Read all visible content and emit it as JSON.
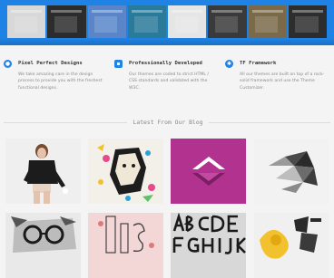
{
  "hero": {
    "thumbnail_colors": [
      "#d8d8d8",
      "#2c2c2c",
      "#5a86c9",
      "#2a7a9a",
      "#e5e5e5",
      "#3a3a3a",
      "#7a6a4a",
      "#2d2d2d"
    ]
  },
  "features": [
    {
      "title": "Pixel Perfect Designs",
      "icon": "camera-icon",
      "text": "We take amazing care in the design process to provide you with the freshest functional designs."
    },
    {
      "title": "Professionally Developed",
      "icon": "code-icon",
      "text": "Our themes are coded to strict HTML / CSS standards and validated with the W3C."
    },
    {
      "title": "TF Framework",
      "icon": "gear-icon",
      "text": "All our themes are built on top of a rock-solid framework and use the Theme Customizer."
    }
  ],
  "blog": {
    "heading": "Latest From Our Blog"
  },
  "posts": [
    {
      "name": "blog-post-woman-leather-jacket"
    },
    {
      "name": "blog-post-colorful-geometric-portrait"
    },
    {
      "name": "blog-post-magenta-triangle"
    },
    {
      "name": "blog-post-polygon-dove"
    },
    {
      "name": "blog-post-sketched-face-glasses"
    },
    {
      "name": "blog-post-pink-typography"
    },
    {
      "name": "blog-post-alphabet-letters"
    },
    {
      "name": "blog-post-yellow-ink-portrait"
    }
  ],
  "colors": {
    "brand_blue": "#1f83e6",
    "magenta": "#b2338f"
  }
}
